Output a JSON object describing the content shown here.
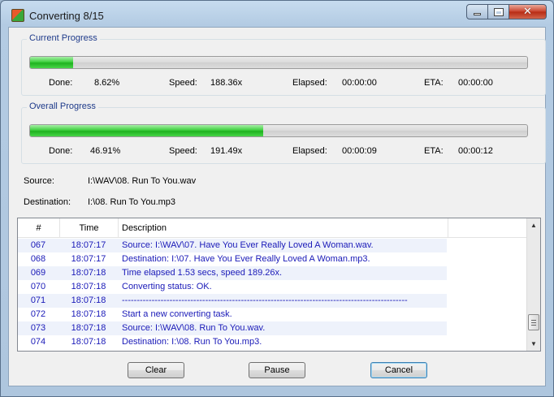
{
  "window": {
    "title": "Converting 8/15"
  },
  "current": {
    "legend": "Current Progress",
    "percent": 8.62,
    "done_label": "Done:",
    "done_value": "8.62%",
    "speed_label": "Speed:",
    "speed_value": "188.36x",
    "elapsed_label": "Elapsed:",
    "elapsed_value": "00:00:00",
    "eta_label": "ETA:",
    "eta_value": "00:00:00"
  },
  "overall": {
    "legend": "Overall Progress",
    "percent": 46.91,
    "done_label": "Done:",
    "done_value": "46.91%",
    "speed_label": "Speed:",
    "speed_value": "191.49x",
    "elapsed_label": "Elapsed:",
    "elapsed_value": "00:00:09",
    "eta_label": "ETA:",
    "eta_value": "00:00:12"
  },
  "source": {
    "label": "Source:",
    "value": "I:\\WAV\\08. Run To You.wav"
  },
  "destination": {
    "label": "Destination:",
    "value": "I:\\08. Run To You.mp3"
  },
  "log": {
    "columns": [
      "#",
      "Time",
      "Description"
    ],
    "rows": [
      {
        "num": "067",
        "time": "18:07:17",
        "desc": "Source:  I:\\WAV\\07. Have You Ever Really Loved A Woman.wav."
      },
      {
        "num": "068",
        "time": "18:07:17",
        "desc": "Destination: I:\\07. Have You Ever Really Loved A Woman.mp3."
      },
      {
        "num": "069",
        "time": "18:07:18",
        "desc": "Time elapsed 1.53 secs, speed 189.26x."
      },
      {
        "num": "070",
        "time": "18:07:18",
        "desc": "Converting status: OK."
      },
      {
        "num": "071",
        "time": "18:07:18",
        "desc": "------------------------------------------------------------------------------------------------"
      },
      {
        "num": "072",
        "time": "18:07:18",
        "desc": "Start a new converting task."
      },
      {
        "num": "073",
        "time": "18:07:18",
        "desc": "Source:  I:\\WAV\\08. Run To You.wav."
      },
      {
        "num": "074",
        "time": "18:07:18",
        "desc": "Destination: I:\\08. Run To You.mp3."
      }
    ]
  },
  "buttons": {
    "clear": "Clear",
    "pause": "Pause",
    "cancel": "Cancel"
  },
  "icons": {
    "app": "converter-app-icon",
    "minimize": "minimize-icon",
    "maximize": "maximize-icon",
    "close": "close-icon"
  },
  "colors": {
    "progress_fill": "#2fc42f",
    "log_text": "#1a1ab8",
    "legend_text": "#1e3a8a"
  }
}
